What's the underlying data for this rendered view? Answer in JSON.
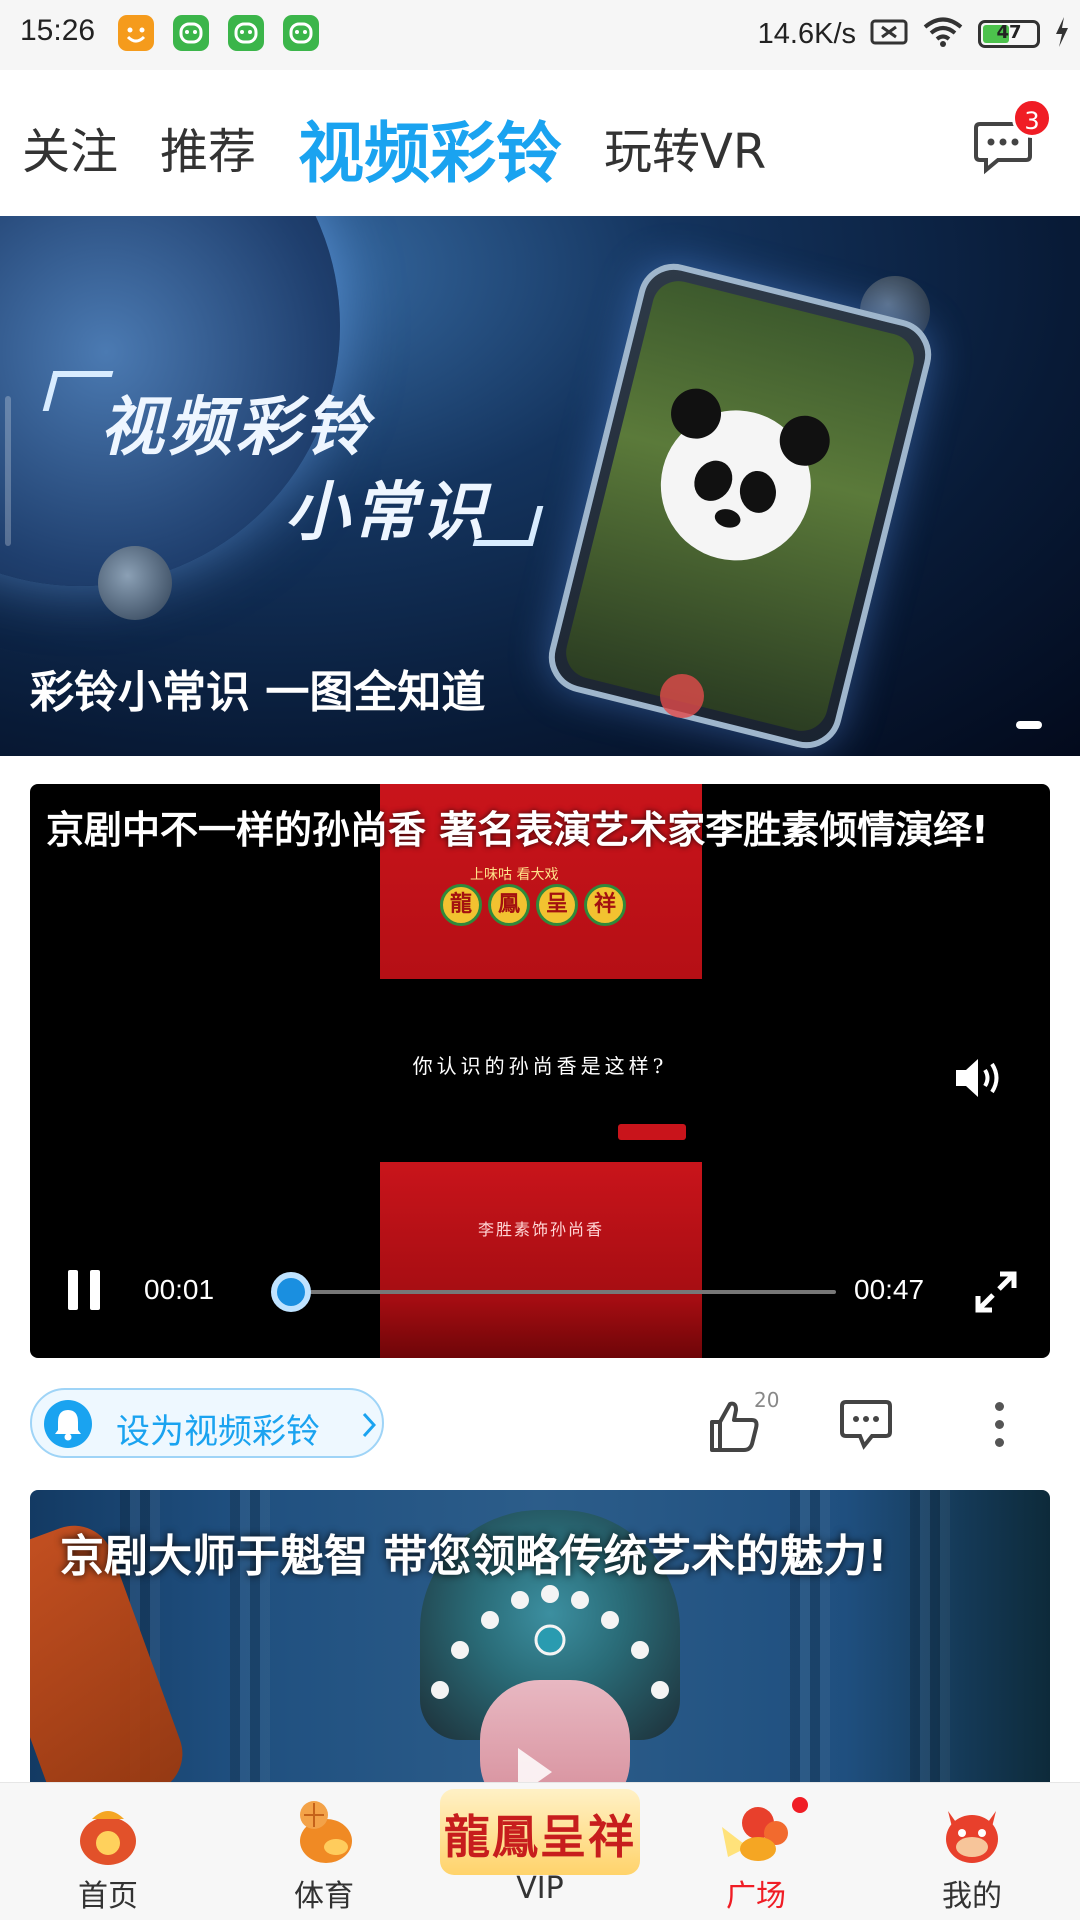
{
  "status_bar": {
    "time": "15:26",
    "net_speed": "14.6K/s",
    "battery": "47",
    "app_icon_colors": [
      "#f59b1c",
      "#3bb54a",
      "#3bb54a",
      "#3bb54a"
    ]
  },
  "top_nav": {
    "tabs": [
      {
        "label": "关注",
        "active": false
      },
      {
        "label": "推荐",
        "active": false
      },
      {
        "label": "视频彩铃",
        "active": true
      },
      {
        "label": "玩转VR",
        "active": false
      }
    ],
    "message_badge": "3",
    "accent_color": "#1aa3f0"
  },
  "banner": {
    "art_title_line1": "视频彩铃",
    "art_title_line2": "小常识",
    "caption": "彩铃小常识 一图全知道"
  },
  "video": {
    "title": "京剧中不一样的孙尚香 著名表演艺术家李胜素倾情演绎!",
    "top_tagline": "上味咕 看大戏",
    "medallion_chars": [
      "龍",
      "鳳",
      "呈",
      "祥"
    ],
    "middle_text": "你认识的孙尚香是这样?",
    "red_text": "李胜素饰孙尚香",
    "current_time": "00:01",
    "duration": "00:47",
    "progress": 0.02
  },
  "actions": {
    "set_ringtone_label": "设为视频彩铃",
    "like_count": "20"
  },
  "second_card": {
    "title": "京剧大师于魁智 带您领略传统艺术的魅力!"
  },
  "bottom_nav": {
    "items": [
      {
        "label": "首页",
        "icon": "home-mascot-icon",
        "active": false
      },
      {
        "label": "体育",
        "icon": "sports-mascot-icon",
        "active": false
      },
      {
        "label": "VIP",
        "icon": "vip-dragon-phoenix-icon",
        "active": false
      },
      {
        "label": "广场",
        "icon": "plaza-mascot-icon",
        "active": true
      },
      {
        "label": "我的",
        "icon": "profile-mascot-icon",
        "active": false
      }
    ],
    "vip_art_text": "龍鳳呈祥",
    "active_color": "#f01d25"
  }
}
